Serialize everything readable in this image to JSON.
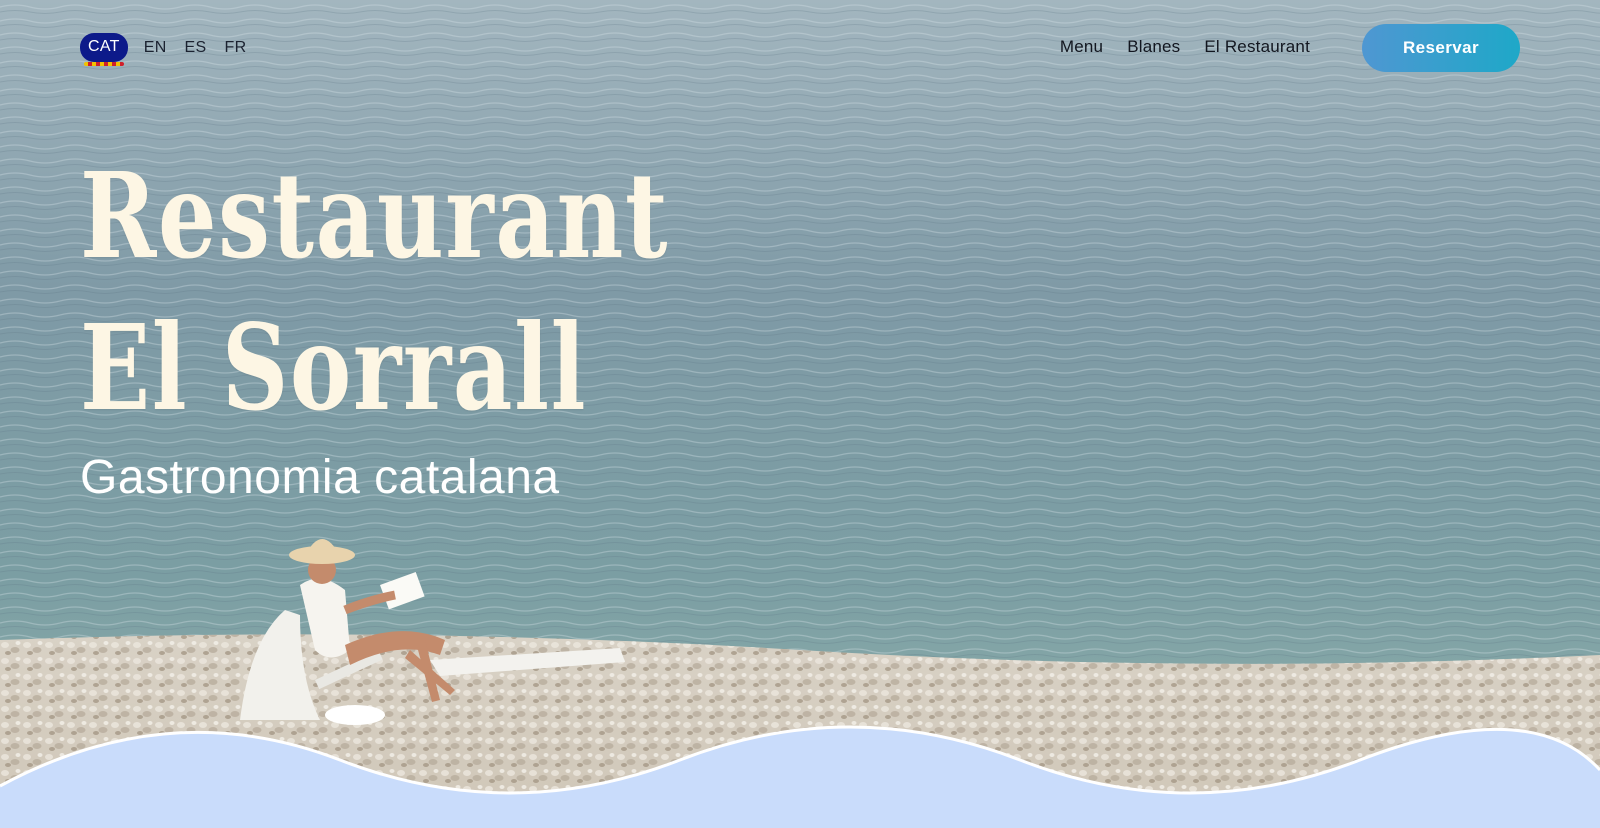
{
  "languages": [
    {
      "code": "CAT",
      "active": true
    },
    {
      "code": "EN",
      "active": false
    },
    {
      "code": "ES",
      "active": false
    },
    {
      "code": "FR",
      "active": false
    }
  ],
  "nav": {
    "items": [
      "Menu",
      "Blanes",
      "El Restaurant"
    ]
  },
  "reserve": {
    "label": "Reservar"
  },
  "hero": {
    "title_line1": "Restaurant",
    "title_line2": "El Sorrall",
    "subtitle": "Gastronomia catalana"
  },
  "colors": {
    "accent_gradient_start": "#4f97d2",
    "accent_gradient_end": "#1ea8c8",
    "active_lang_bg": "#0d1a8a",
    "title_color": "#fdf6e4",
    "wave_fill": "#c9dcfb"
  }
}
